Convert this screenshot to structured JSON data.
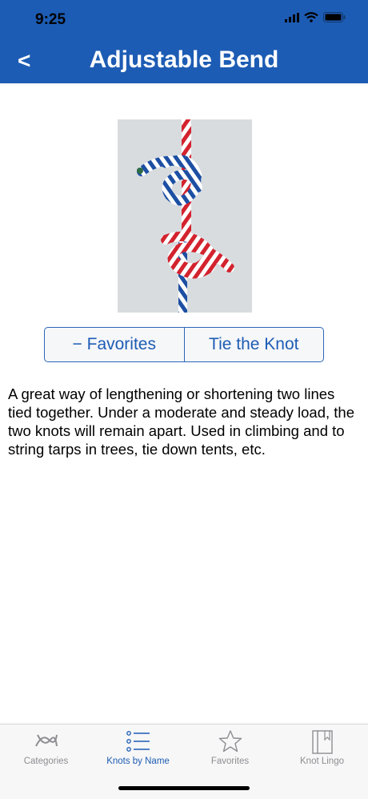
{
  "status_bar": {
    "time": "9:25"
  },
  "nav": {
    "back_label": "<",
    "title": "Adjustable Bend"
  },
  "segmented": {
    "favorites_label": "− Favorites",
    "tie_label": "Tie the Knot"
  },
  "description": "A great way of lengthening or shortening two lines tied together. Under a moderate and steady load, the two knots will remain apart. Used in climbing and to string tarps in trees, tie down tents, etc.",
  "tabs": [
    {
      "label": "Categories",
      "icon": "knot-icon",
      "active": false
    },
    {
      "label": "Knots by Name",
      "icon": "list-icon",
      "active": true
    },
    {
      "label": "Favorites",
      "icon": "star-icon",
      "active": false
    },
    {
      "label": "Knot Lingo",
      "icon": "book-icon",
      "active": false
    }
  ],
  "colors": {
    "brand": "#1d5cb4",
    "tab_inactive": "#8e8e93"
  }
}
